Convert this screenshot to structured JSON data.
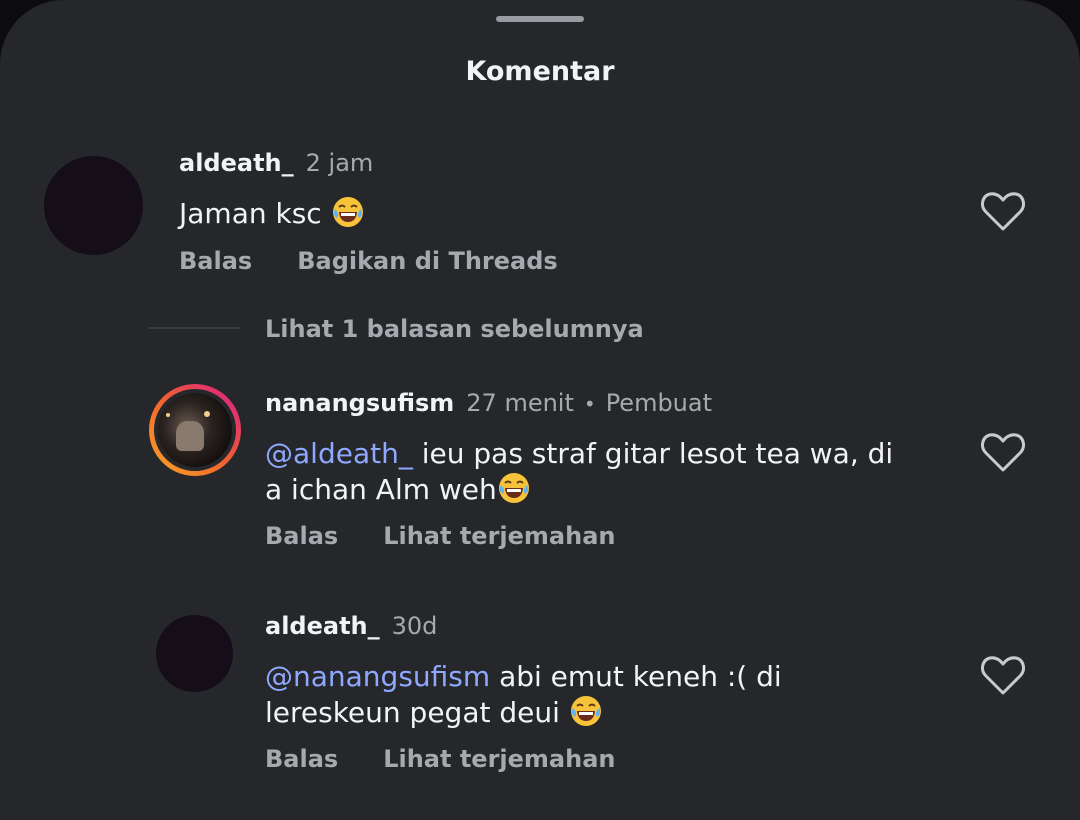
{
  "sheet": {
    "title": "Komentar"
  },
  "comments": [
    {
      "username": "aldeath_",
      "time": "2 jam",
      "text": "Jaman ksc",
      "emoji": "😂",
      "actions": [
        "Balas",
        "Bagikan di Threads"
      ]
    }
  ],
  "replies_toggle": "Lihat 1 balasan sebelumnya",
  "replies": [
    {
      "username": "nanangsufism",
      "time": "27 menit",
      "badge": "Pembuat",
      "mention_symbol": "@",
      "mention": "aldeath_",
      "text_line1": " ieu pas straf gitar lesot tea wa, di",
      "text_line2": "a ichan Alm weh",
      "emoji": "😂",
      "actions": [
        "Balas",
        "Lihat terjemahan"
      ]
    },
    {
      "username": "aldeath_",
      "time": "30d",
      "mention_symbol": "@",
      "mention": "nanangsufism",
      "text_line1": " abi emut keneh :( di",
      "text_line2": "lereskeun pegat deui",
      "emoji": "😂",
      "actions": [
        "Balas",
        "Lihat terjemahan"
      ]
    }
  ],
  "colors": {
    "background": "#25272b",
    "text": "#f2f3f5",
    "muted": "#a8a9ae",
    "mention": "#8fa8ff",
    "story_ring_start": "#f9a825",
    "story_ring_end": "#d81b8c"
  },
  "icons": [
    "heart-outline-icon",
    "threads-mention-icon",
    "face-with-tears-of-joy-emoji"
  ]
}
